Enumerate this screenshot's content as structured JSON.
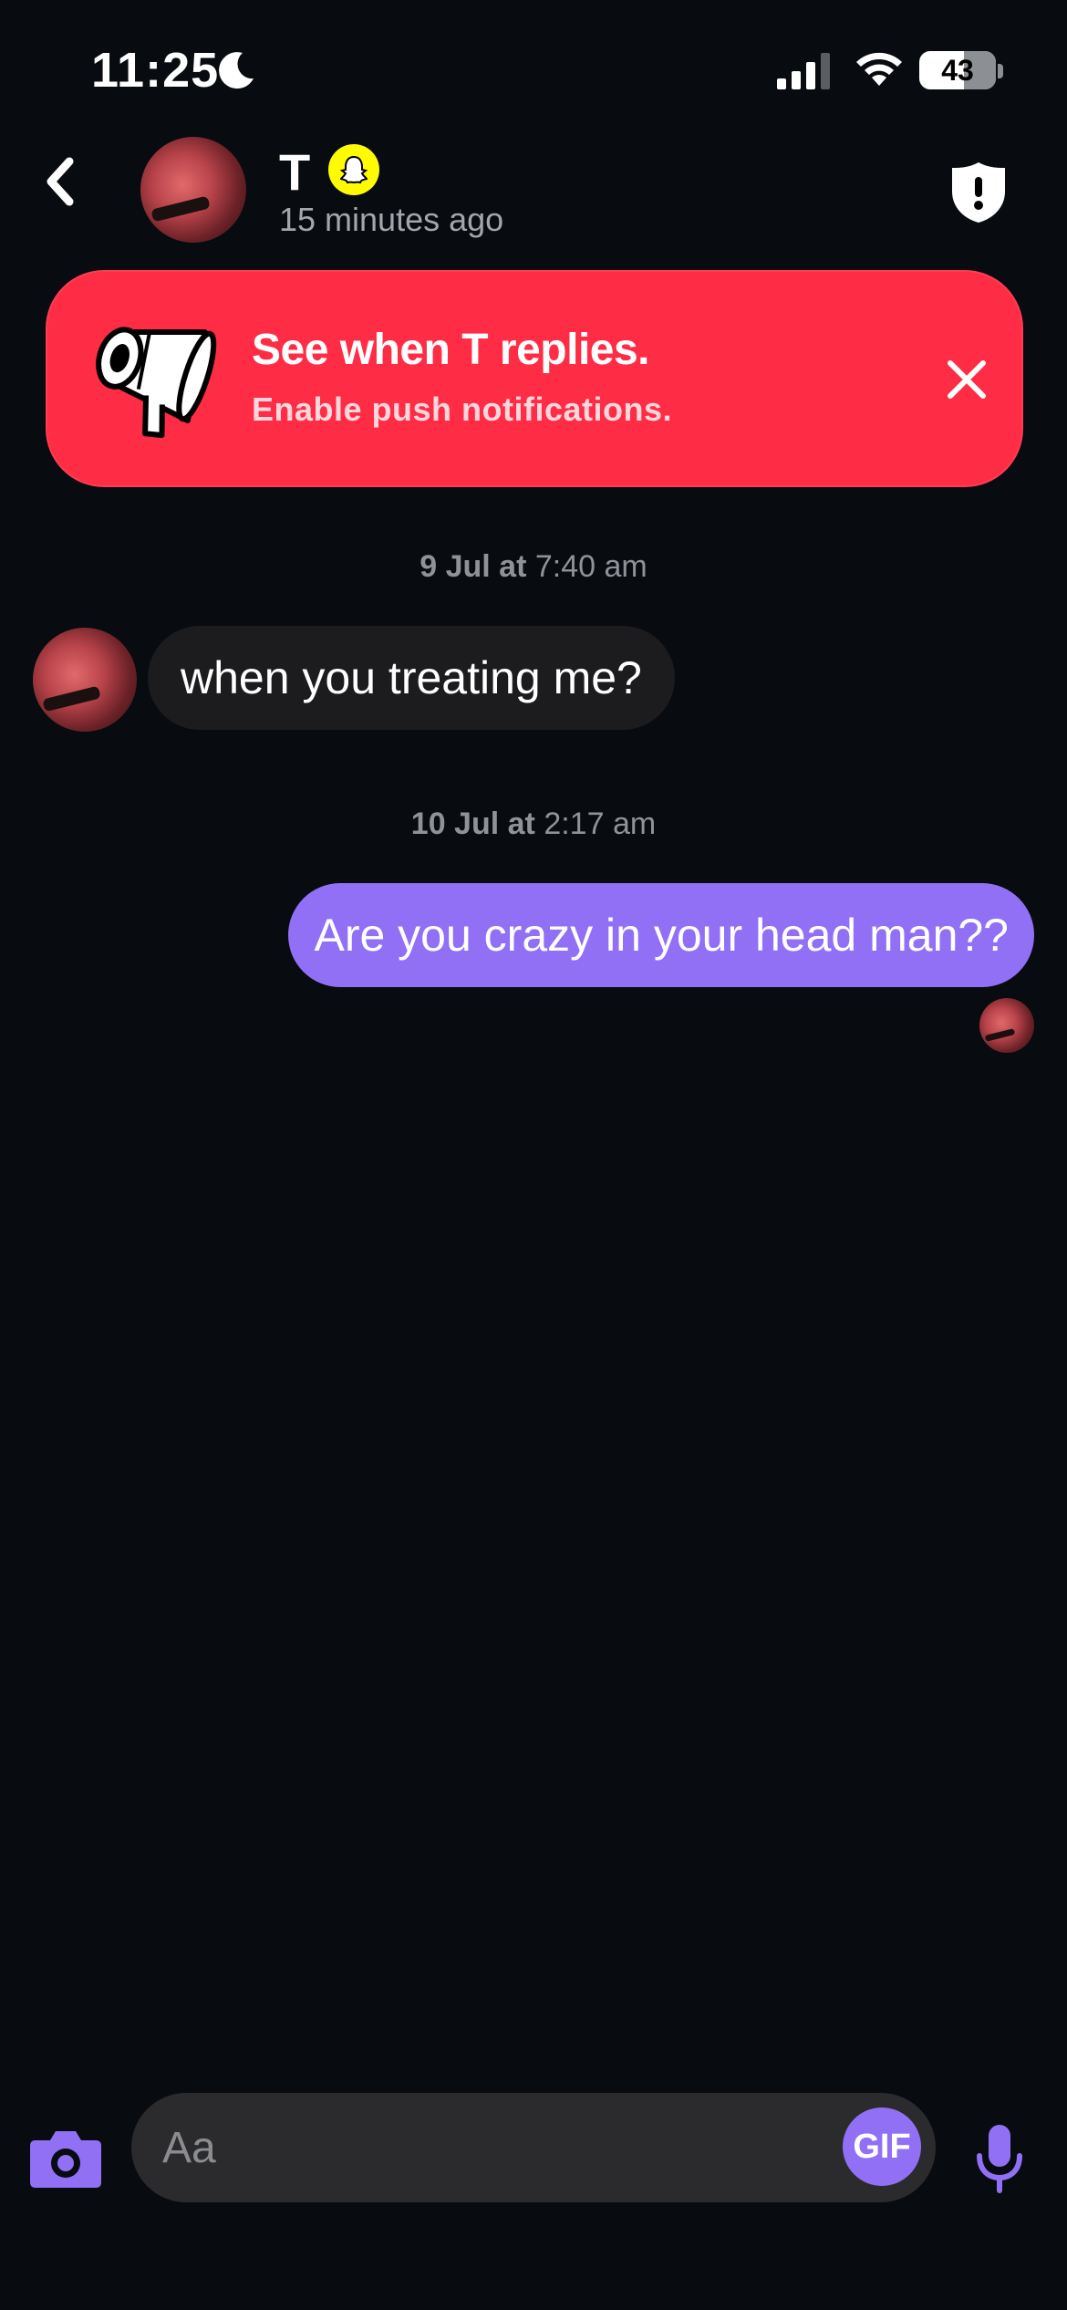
{
  "status_bar": {
    "time": "11:25",
    "battery": "43"
  },
  "header": {
    "name": "T",
    "last_seen": "15 minutes ago"
  },
  "banner": {
    "title": "See when T replies.",
    "subtitle": "Enable push notifications."
  },
  "messages": [
    {
      "date_bold": "9 Jul at",
      "time": "7:40 am",
      "text": "when you treating me?",
      "direction": "incoming"
    },
    {
      "date_bold": "10 Jul at",
      "time": "2:17 am",
      "text": "Are you crazy in your head man??",
      "direction": "outgoing"
    }
  ],
  "composer": {
    "placeholder": "Aa",
    "gif_label": "GIF"
  },
  "colors": {
    "accent": "#9170f6",
    "banner": "#fe2c45",
    "snap_yellow": "#fffc00",
    "background": "#080b10"
  },
  "icons": [
    "moon-icon",
    "signal-icon",
    "wifi-icon",
    "back-chevron-icon",
    "ghost-icon",
    "shield-alert-icon",
    "megaphone-icon",
    "close-icon",
    "camera-icon",
    "microphone-icon"
  ]
}
